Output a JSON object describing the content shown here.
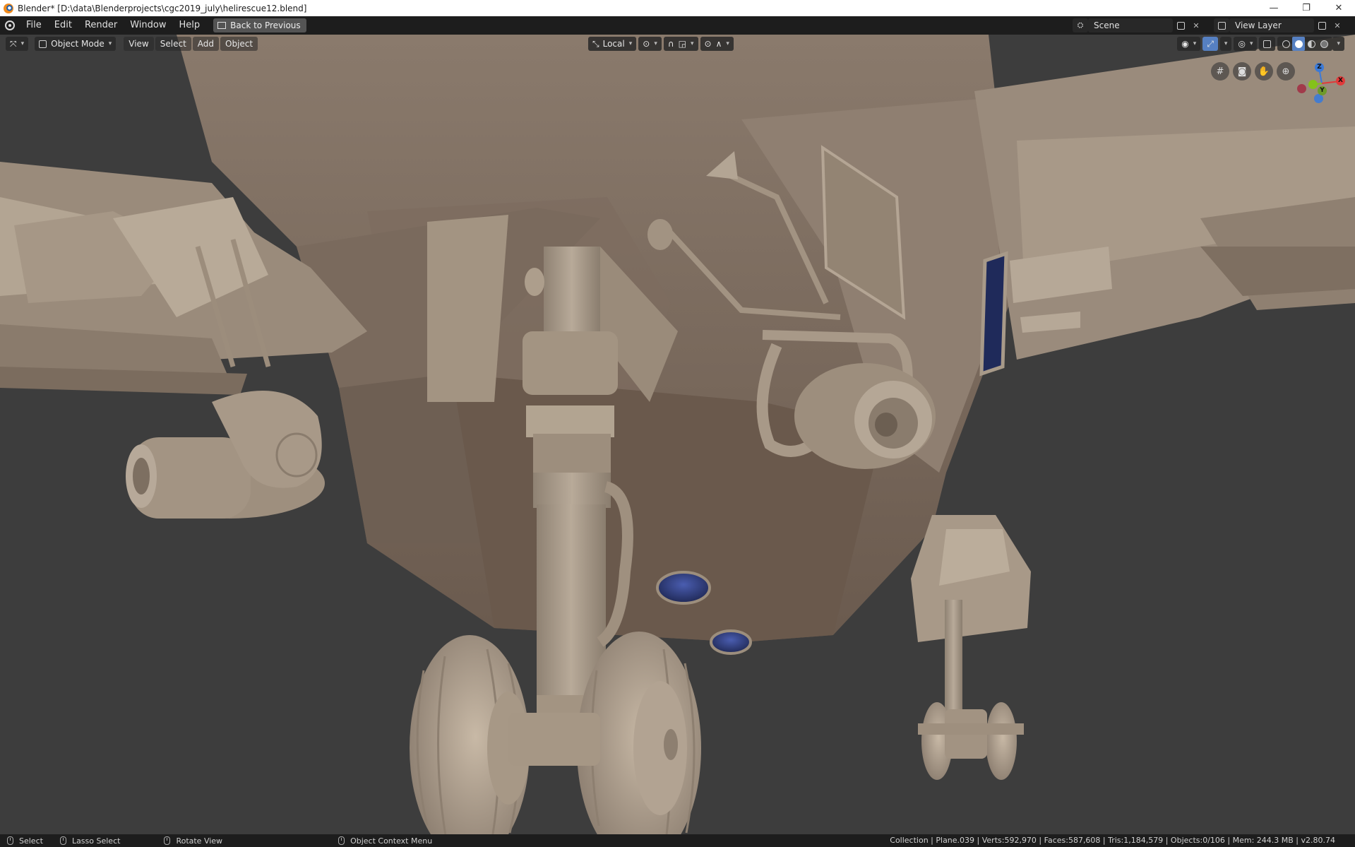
{
  "window": {
    "title": "Blender* [D:\\data\\Blenderprojects\\cgc2019_july\\helirescue12.blend]",
    "controls": [
      "—",
      "❐",
      "✕"
    ]
  },
  "topbar": {
    "menus": [
      "File",
      "Edit",
      "Render",
      "Window",
      "Help"
    ],
    "back_button": "Back to Previous",
    "scene": "Scene",
    "view_layer": "View Layer"
  },
  "viewport_header": {
    "mode": "Object Mode",
    "menus": [
      "View",
      "Select",
      "Add",
      "Object"
    ],
    "transform_orientation": "Local"
  },
  "gizmo": {
    "z": "Z",
    "y": "Y",
    "x": "X"
  },
  "statusbar": {
    "hints": [
      {
        "label": "Select"
      },
      {
        "label": "Lasso Select"
      },
      {
        "label": "Rotate View"
      },
      {
        "label": "Object Context Menu"
      }
    ],
    "stats": "Collection | Plane.039 | Verts:592,970 | Faces:587,608 | Tris:1,184,579 | Objects:0/106 | Mem: 244.3 MB | v2.80.74"
  },
  "colors": {
    "background": "#3d3d3d",
    "model": "#a69888",
    "accent": "#5680c2",
    "lens": "#2e3a7a"
  }
}
